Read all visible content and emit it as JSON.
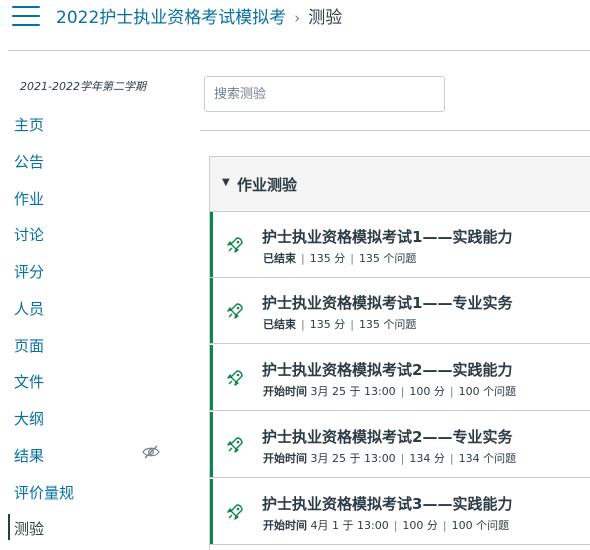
{
  "breadcrumb": {
    "course": "2022护士执业资格考试模拟考",
    "separator": "›",
    "current": "测验"
  },
  "sidebar": {
    "term": "2021-2022学年第二学期",
    "items": [
      {
        "label": "主页"
      },
      {
        "label": "公告"
      },
      {
        "label": "作业"
      },
      {
        "label": "讨论"
      },
      {
        "label": "评分"
      },
      {
        "label": "人员"
      },
      {
        "label": "页面"
      },
      {
        "label": "文件"
      },
      {
        "label": "大纲"
      },
      {
        "label": "结果",
        "icon": "eye-slash-icon"
      },
      {
        "label": "评价量规"
      },
      {
        "label": "测验",
        "active": true
      }
    ]
  },
  "search": {
    "placeholder": "搜索测验",
    "value": ""
  },
  "group": {
    "title": "作业测验",
    "quizzes": [
      {
        "title": "护士执业资格模拟考试1——实践能力",
        "status": "已结束",
        "points": "135 分",
        "questions": "135 个问题"
      },
      {
        "title": "护士执业资格模拟考试1——专业实务",
        "status": "已结束",
        "points": "135 分",
        "questions": "135 个问题"
      },
      {
        "title": "护士执业资格模拟考试2——实践能力",
        "status": "开始时间",
        "date": "3月 25 于 13:00",
        "points": "100 分",
        "questions": "100 个问题"
      },
      {
        "title": "护士执业资格模拟考试2——专业实务",
        "status": "开始时间",
        "date": "3月 25 于 13:00",
        "points": "134 分",
        "questions": "134 个问题"
      },
      {
        "title": "护士执业资格模拟考试3——实践能力",
        "status": "开始时间",
        "date": "4月 1 于 13:00",
        "points": "100 分",
        "questions": "100 个问题"
      }
    ]
  },
  "colors": {
    "link": "#0770a3",
    "published": "#0b874b",
    "text": "#2d3b45",
    "border": "#c7cdd1"
  }
}
